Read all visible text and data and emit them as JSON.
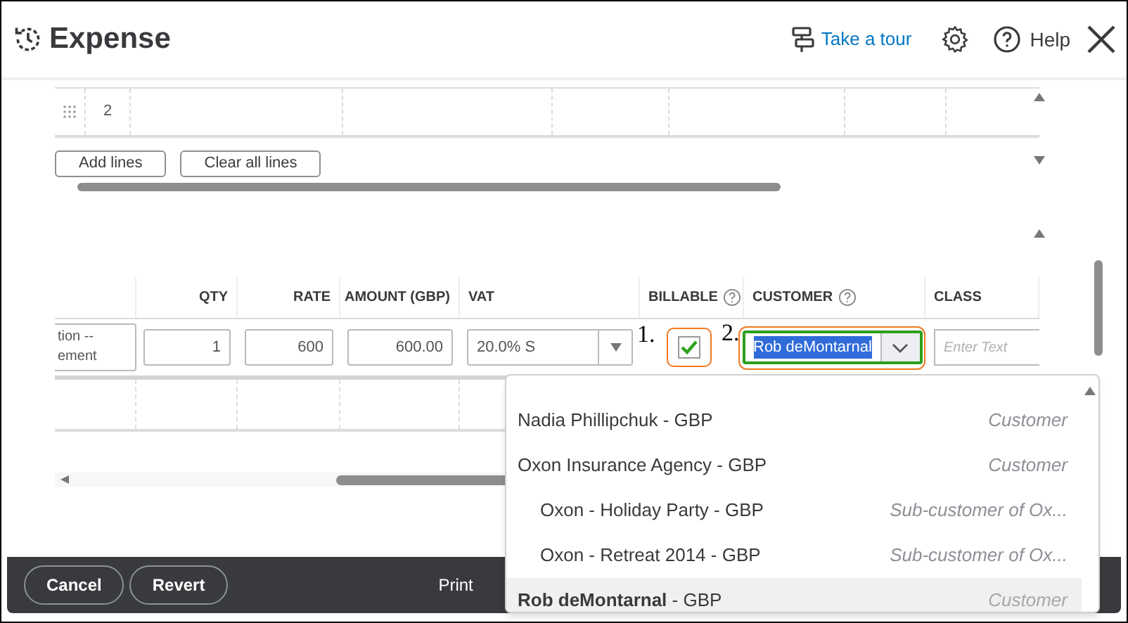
{
  "header": {
    "title": "Expense",
    "tour": "Take a tour",
    "help": "Help"
  },
  "upper_table": {
    "rows": [
      {
        "number": "2"
      }
    ],
    "buttons": [
      "Add lines",
      "Clear all lines"
    ]
  },
  "lower_table": {
    "columns": [
      {
        "label": "QTY",
        "help": false
      },
      {
        "label": "RATE",
        "help": false
      },
      {
        "label": "AMOUNT (GBP)",
        "help": false
      },
      {
        "label": "VAT",
        "help": false
      },
      {
        "label": "BILLABLE",
        "help": true
      },
      {
        "label": "CUSTOMER",
        "help": true
      },
      {
        "label": "CLASS",
        "help": false
      }
    ],
    "row": {
      "description": [
        "tion --",
        "ement"
      ],
      "qty": "1",
      "rate": "600",
      "amount": "600.00",
      "vat": "20.0% S",
      "billable": true,
      "customer": "Rob deMontarnal",
      "customer_highlighted": true,
      "class_placeholder": "Enter Text"
    }
  },
  "annotations": [
    "1.",
    "2."
  ],
  "customer_dropdown": [
    {
      "name": "Nadia Phillipchuk",
      "currency": " - GBP",
      "type": "Customer",
      "selected": false
    },
    {
      "name": "Oxon Insurance Agency",
      "currency": " - GBP",
      "type": "Customer",
      "selected": false,
      "children": [
        {
          "name": "Oxon - Holiday Party",
          "currency": " - GBP",
          "type": "Sub-customer of Ox...",
          "selected": false
        },
        {
          "name": "Oxon - Retreat 2014",
          "currency": " - GBP",
          "type": "Sub-customer of Ox...",
          "selected": false
        }
      ]
    },
    {
      "name": "Rob deMontarnal",
      "currency": " - GBP",
      "type": "Customer",
      "selected": true
    }
  ],
  "footer": {
    "buttons": [
      "Cancel",
      "Revert"
    ],
    "print": "Print"
  }
}
